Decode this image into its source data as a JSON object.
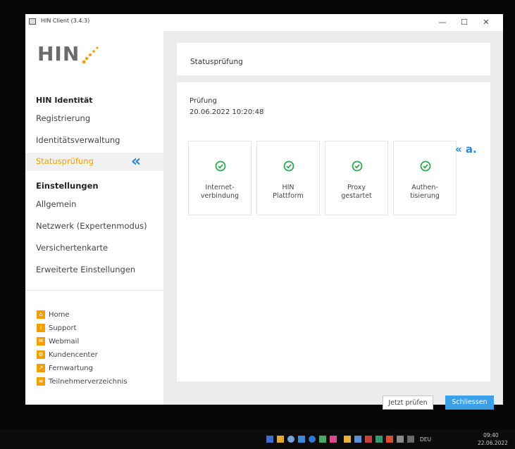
{
  "window": {
    "title": "HIN Client (3.4.3)"
  },
  "logo": {
    "text": "HIN"
  },
  "sidebar": {
    "identity_section": "HIN Identität",
    "identity_items": [
      "Registrierung",
      "Identitätsverwaltung",
      "Statusprüfung"
    ],
    "active_item": "Statusprüfung",
    "settings_section": "Einstellungen",
    "settings_items": [
      "Allgemein",
      "Netzwerk (Expertenmodus)",
      "Versichertenkarte",
      "Erweiterte Einstellungen"
    ],
    "links": [
      {
        "label": "Home",
        "icon": "home-icon"
      },
      {
        "label": "Support",
        "icon": "info-icon"
      },
      {
        "label": "Webmail",
        "icon": "mail-icon"
      },
      {
        "label": "Kundencenter",
        "icon": "gear-icon"
      },
      {
        "label": "Fernwartung",
        "icon": "remote-icon"
      },
      {
        "label": "Teilnehmerverzeichnis",
        "icon": "directory-icon"
      }
    ]
  },
  "main": {
    "page_title": "Statusprüfung",
    "check_label": "Prüfung",
    "check_timestamp": "20.06.2022 10:20:48",
    "tiles": [
      {
        "line1": "Internet-",
        "line2": "verbindung",
        "status": "ok"
      },
      {
        "line1": "HIN",
        "line2": "Plattform",
        "status": "ok"
      },
      {
        "line1": "Proxy",
        "line2": "gestartet",
        "status": "ok"
      },
      {
        "line1": "Authen-",
        "line2": "tisierung",
        "status": "ok"
      }
    ],
    "buttons": {
      "check_now": "Jetzt prüfen",
      "close": "Schliessen"
    }
  },
  "annotation": {
    "arrow": "«",
    "label": "« a."
  },
  "taskbar": {
    "language": "DEU",
    "time": "09:40",
    "date": "22.06.2022"
  },
  "colors": {
    "accent": "#f0a000",
    "primary": "#3aa0e8",
    "status_ok": "#2fa84f",
    "annotation": "#2a87d8"
  }
}
